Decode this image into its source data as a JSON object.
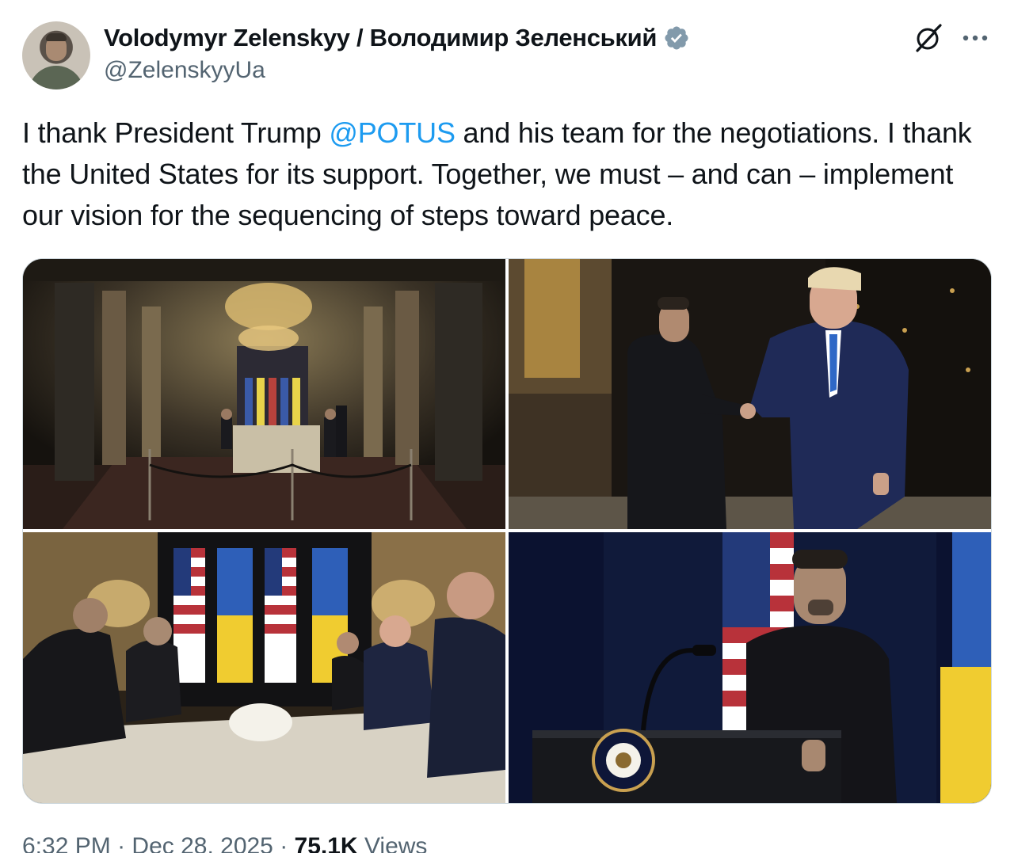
{
  "author": {
    "display_name": "Volodymyr Zelenskyy / Володимир Зеленський",
    "handle": "@ZelenskyyUa",
    "verified": true,
    "verified_color": "#829aab"
  },
  "tweet": {
    "text_part1": "I thank President Trump ",
    "mention": "@POTUS",
    "text_part2": " and his team for the negotiations. I thank the United States for its support. Together, we must – and can – implement our vision for the sequencing of steps toward peace."
  },
  "media": {
    "count": 4,
    "photos": [
      {
        "subject": "dining-room-wide-shot"
      },
      {
        "subject": "handshake"
      },
      {
        "subject": "delegations-at-table"
      },
      {
        "subject": "press-conference-podium"
      }
    ]
  },
  "meta": {
    "time": "6:32 PM",
    "separator1": " · ",
    "date": "Dec 28, 2025",
    "separator2": " · ",
    "views_count": "75.1K",
    "views_label": " Views"
  },
  "icons": {
    "grok": "grok-icon",
    "more": "more-icon",
    "verified": "verified-badge-icon"
  },
  "colors": {
    "accent": "#1d9bf0",
    "secondary_text": "#536471",
    "primary_text": "#0f1419"
  }
}
